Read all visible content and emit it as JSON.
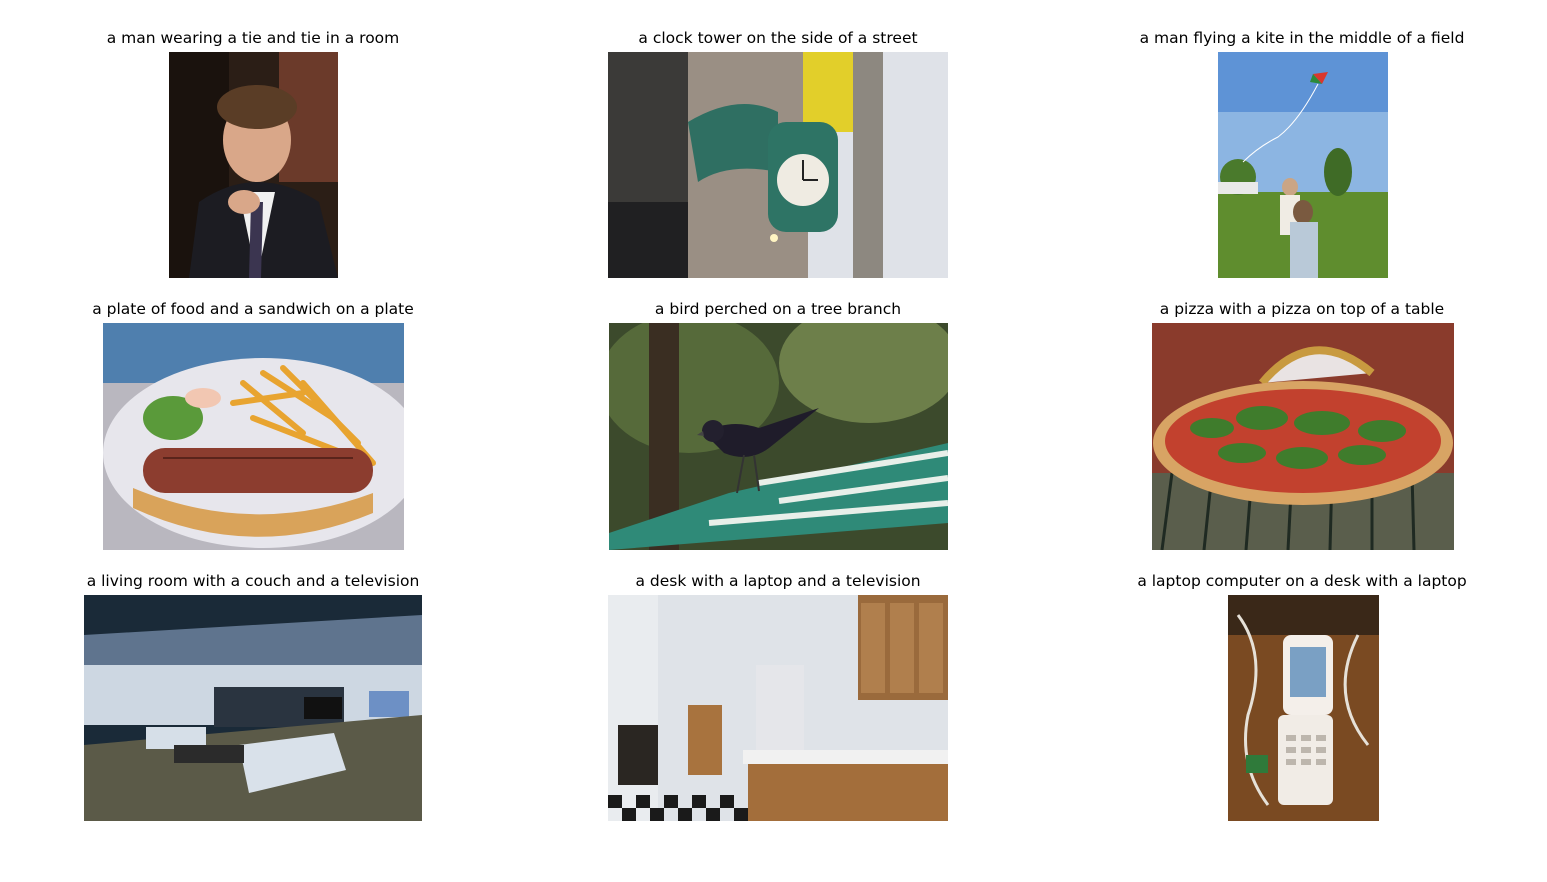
{
  "figure": {
    "panels": [
      {
        "caption": "a man wearing a tie and tie in a room",
        "image": "photo of a young man in a dark suit adjusting his tie"
      },
      {
        "caption": "a clock tower on the side of a street",
        "image": "ornate green street clock mounted on a building"
      },
      {
        "caption": "a man flying a kite in the middle of a field",
        "image": "two children flying a kite on a grassy field"
      },
      {
        "caption": "a plate of food and a sandwich on a plate",
        "image": "plate with a grilled sausage in a bun and french fries"
      },
      {
        "caption": "a bird perched on a tree branch",
        "image": "black bird perched on a green and white striped awning"
      },
      {
        "caption": "a pizza with a pizza on top of a table",
        "image": "large flatbread pizza topped with arugula on a table"
      },
      {
        "caption": "a living room with a couch and a television",
        "image": "modern living room with white couches and a television"
      },
      {
        "caption": "a desk with a laptop and a television",
        "image": "apartment kitchen with wooden cabinets and a counter"
      },
      {
        "caption": "a laptop computer on a desk with a laptop",
        "image": "white flip phone on a wooden desk with cables"
      }
    ]
  }
}
